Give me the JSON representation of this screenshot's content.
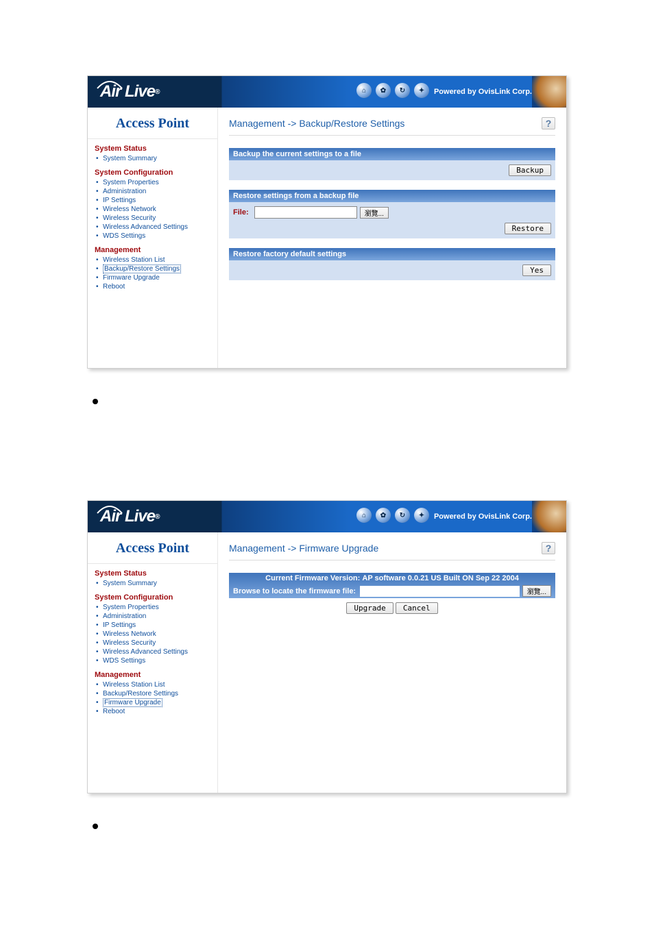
{
  "brand": {
    "name": "Air Live",
    "powered": "Powered by OvisLink Corp."
  },
  "sidebar": {
    "title": "Access Point",
    "groups": [
      {
        "heading": "System Status",
        "items": [
          "System Summary"
        ]
      },
      {
        "heading": "System Configuration",
        "items": [
          "System Properties",
          "Administration",
          "IP Settings",
          "Wireless Network",
          "Wireless Security",
          "Wireless Advanced Settings",
          "WDS Settings"
        ]
      },
      {
        "heading": "Management",
        "items": [
          "Wireless Station List",
          "Backup/Restore Settings",
          "Firmware Upgrade",
          "Reboot"
        ]
      }
    ]
  },
  "panel1": {
    "breadcrumb": "Management -> Backup/Restore Settings",
    "help": "?",
    "s1": {
      "title": "Backup the current settings to a file",
      "button": "Backup"
    },
    "s2": {
      "title": "Restore settings from a backup file",
      "file_label": "File:",
      "browse": "瀏覽...",
      "button": "Restore"
    },
    "s3": {
      "title": "Restore factory default settings",
      "button": "Yes"
    }
  },
  "panel2": {
    "breadcrumb": "Management -> Firmware Upgrade",
    "help": "?",
    "fw": {
      "label": "Current Firmware Version:",
      "value": "AP software 0.0.21 US Built ON Sep 22 2004",
      "browse_label": "Browse to locate the firmware file:",
      "browse": "瀏覽...",
      "upgrade": "Upgrade",
      "cancel": "Cancel"
    }
  }
}
